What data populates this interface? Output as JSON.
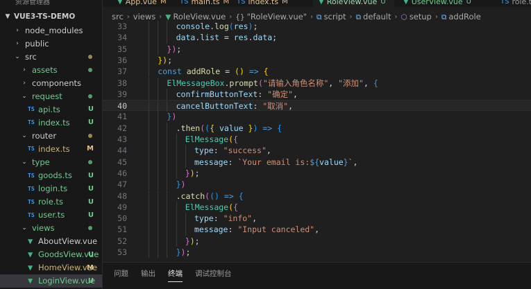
{
  "sidebar": {
    "header": "资源管理器",
    "project": "VUE3-TS-DEMO",
    "items": [
      {
        "label": "node_modules",
        "kind": "folder",
        "depth": 1,
        "open": false,
        "status": "",
        "color": "normal"
      },
      {
        "label": "public",
        "kind": "folder",
        "depth": 1,
        "open": false,
        "status": "",
        "color": "normal"
      },
      {
        "label": "src",
        "kind": "folder",
        "depth": 1,
        "open": true,
        "status": "dot",
        "color": "normal"
      },
      {
        "label": "assets",
        "kind": "folder",
        "depth": 2,
        "open": false,
        "status": "dot-green",
        "color": "folder-git"
      },
      {
        "label": "components",
        "kind": "folder",
        "depth": 2,
        "open": false,
        "status": "",
        "color": "normal"
      },
      {
        "label": "request",
        "kind": "folder",
        "depth": 2,
        "open": true,
        "status": "dot-green",
        "color": "folder-git"
      },
      {
        "label": "api.ts",
        "kind": "ts",
        "depth": 3,
        "open": false,
        "status": "U",
        "color": "untracked"
      },
      {
        "label": "index.ts",
        "kind": "ts",
        "depth": 3,
        "open": false,
        "status": "U",
        "color": "untracked"
      },
      {
        "label": "router",
        "kind": "folder",
        "depth": 2,
        "open": true,
        "status": "dot",
        "color": "normal"
      },
      {
        "label": "index.ts",
        "kind": "ts",
        "depth": 3,
        "open": false,
        "status": "M",
        "color": "modified"
      },
      {
        "label": "type",
        "kind": "folder",
        "depth": 2,
        "open": true,
        "status": "dot-green",
        "color": "folder-git"
      },
      {
        "label": "goods.ts",
        "kind": "ts",
        "depth": 3,
        "open": false,
        "status": "U",
        "color": "untracked"
      },
      {
        "label": "login.ts",
        "kind": "ts",
        "depth": 3,
        "open": false,
        "status": "U",
        "color": "untracked"
      },
      {
        "label": "role.ts",
        "kind": "ts",
        "depth": 3,
        "open": false,
        "status": "U",
        "color": "untracked"
      },
      {
        "label": "user.ts",
        "kind": "ts",
        "depth": 3,
        "open": false,
        "status": "U",
        "color": "untracked"
      },
      {
        "label": "views",
        "kind": "folder",
        "depth": 2,
        "open": true,
        "status": "dot-green",
        "color": "folder-git"
      },
      {
        "label": "AboutView.vue",
        "kind": "vue",
        "depth": 3,
        "open": false,
        "status": "",
        "color": "normal"
      },
      {
        "label": "GoodsView.vue",
        "kind": "vue",
        "depth": 3,
        "open": false,
        "status": "U",
        "color": "untracked"
      },
      {
        "label": "HomeView.vue",
        "kind": "vue",
        "depth": 3,
        "open": false,
        "status": "M",
        "color": "modified"
      },
      {
        "label": "LoginView.vue",
        "kind": "vue",
        "depth": 3,
        "open": false,
        "status": "U",
        "color": "untracked"
      }
    ]
  },
  "tabs": [
    {
      "label": "App.vue",
      "icon": "vue",
      "status": "M",
      "active": false
    },
    {
      "label": "main.ts",
      "icon": "ts",
      "status": "M",
      "active": false
    },
    {
      "label": "index.ts",
      "icon": "ts",
      "status": "M",
      "active": false
    },
    {
      "label": "RoleView.vue",
      "icon": "vue",
      "status": "U",
      "active": true
    },
    {
      "label": "UserView.vue",
      "icon": "vue",
      "status": "U",
      "active": false
    },
    {
      "label": "role.ts",
      "icon": "ts",
      "status": "",
      "active": false
    }
  ],
  "breadcrumb": [
    {
      "label": "src",
      "icon": ""
    },
    {
      "label": "views",
      "icon": ""
    },
    {
      "label": "RoleView.vue",
      "icon": "vue"
    },
    {
      "label": "\"RoleView.vue\"",
      "icon": "{}"
    },
    {
      "label": "script",
      "icon": "box"
    },
    {
      "label": "default",
      "icon": "box"
    },
    {
      "label": "setup",
      "icon": "cube"
    },
    {
      "label": "addRole",
      "icon": "box"
    }
  ],
  "editor": {
    "current_line": 40,
    "lines": [
      {
        "n": 33,
        "indent": 3,
        "tokens": [
          [
            "var",
            "console"
          ],
          [
            "txt",
            "."
          ],
          [
            "fn",
            "log"
          ],
          [
            "p3",
            "("
          ],
          [
            "var",
            "res"
          ],
          [
            "p3",
            ")"
          ],
          [
            "txt",
            ";"
          ]
        ]
      },
      {
        "n": 34,
        "indent": 3,
        "tokens": [
          [
            "var",
            "data"
          ],
          [
            "txt",
            "."
          ],
          [
            "var",
            "list"
          ],
          [
            "txt",
            " = "
          ],
          [
            "var",
            "res"
          ],
          [
            "txt",
            "."
          ],
          [
            "var",
            "data"
          ],
          [
            "txt",
            ";"
          ]
        ]
      },
      {
        "n": 35,
        "indent": 2,
        "tokens": [
          [
            "p2",
            "}"
          ],
          [
            "p2",
            ")"
          ],
          [
            "txt",
            ";"
          ]
        ]
      },
      {
        "n": 36,
        "indent": 1,
        "tokens": [
          [
            "p1",
            "}"
          ],
          [
            "p1",
            ")"
          ],
          [
            "txt",
            ";"
          ]
        ]
      },
      {
        "n": 37,
        "indent": 1,
        "tokens": [
          [
            "kw",
            "const"
          ],
          [
            "txt",
            " "
          ],
          [
            "fn",
            "addRole"
          ],
          [
            "txt",
            " = "
          ],
          [
            "p1",
            "("
          ],
          [
            "p1",
            ")"
          ],
          [
            "txt",
            " "
          ],
          [
            "kw",
            "=>"
          ],
          [
            "txt",
            " "
          ],
          [
            "p1",
            "{"
          ]
        ]
      },
      {
        "n": 38,
        "indent": 2,
        "tokens": [
          [
            "cls",
            "ElMessageBox"
          ],
          [
            "txt",
            "."
          ],
          [
            "fn",
            "prompt"
          ],
          [
            "p2",
            "("
          ],
          [
            "str",
            "\"请输入角色名称\""
          ],
          [
            "txt",
            ", "
          ],
          [
            "str",
            "\"添加\""
          ],
          [
            "txt",
            ", "
          ],
          [
            "p3",
            "{"
          ]
        ]
      },
      {
        "n": 39,
        "indent": 3,
        "tokens": [
          [
            "var",
            "confirmButtonText"
          ],
          [
            "txt",
            ": "
          ],
          [
            "str",
            "\"确定\""
          ],
          [
            "txt",
            ","
          ]
        ]
      },
      {
        "n": 40,
        "indent": 3,
        "tokens": [
          [
            "var",
            "cancelButtonText"
          ],
          [
            "txt",
            ": "
          ],
          [
            "str",
            "\"取消\""
          ],
          [
            "txt",
            ","
          ]
        ]
      },
      {
        "n": 41,
        "indent": 2,
        "tokens": [
          [
            "p3",
            "}"
          ],
          [
            "p2",
            ")"
          ]
        ]
      },
      {
        "n": 42,
        "indent": 3,
        "tokens": [
          [
            "txt",
            "."
          ],
          [
            "fn",
            "then"
          ],
          [
            "p2",
            "("
          ],
          [
            "p3",
            "("
          ],
          [
            "p1",
            "{"
          ],
          [
            "txt",
            " "
          ],
          [
            "var",
            "value"
          ],
          [
            "txt",
            " "
          ],
          [
            "p1",
            "}"
          ],
          [
            "p3",
            ")"
          ],
          [
            "txt",
            " "
          ],
          [
            "kw",
            "=>"
          ],
          [
            "txt",
            " "
          ],
          [
            "p3",
            "{"
          ]
        ]
      },
      {
        "n": 43,
        "indent": 4,
        "tokens": [
          [
            "cls",
            "ElMessage"
          ],
          [
            "p1",
            "("
          ],
          [
            "p2",
            "{"
          ]
        ]
      },
      {
        "n": 44,
        "indent": 5,
        "tokens": [
          [
            "var",
            "type"
          ],
          [
            "txt",
            ": "
          ],
          [
            "str",
            "\"success\""
          ],
          [
            "txt",
            ","
          ]
        ]
      },
      {
        "n": 45,
        "indent": 5,
        "tokens": [
          [
            "var",
            "message"
          ],
          [
            "txt",
            ": "
          ],
          [
            "str",
            "`Your email is:"
          ],
          [
            "kw",
            "${"
          ],
          [
            "var",
            "value"
          ],
          [
            "kw",
            "}"
          ],
          [
            "str",
            "`"
          ],
          [
            "txt",
            ","
          ]
        ]
      },
      {
        "n": 46,
        "indent": 4,
        "tokens": [
          [
            "p2",
            "}"
          ],
          [
            "p1",
            ")"
          ],
          [
            "txt",
            ";"
          ]
        ]
      },
      {
        "n": 47,
        "indent": 3,
        "tokens": [
          [
            "p3",
            "}"
          ],
          [
            "p2",
            ")"
          ]
        ]
      },
      {
        "n": 48,
        "indent": 3,
        "tokens": [
          [
            "txt",
            "."
          ],
          [
            "fn",
            "catch"
          ],
          [
            "p2",
            "("
          ],
          [
            "p3",
            "("
          ],
          [
            "p3",
            ")"
          ],
          [
            "txt",
            " "
          ],
          [
            "kw",
            "=>"
          ],
          [
            "txt",
            " "
          ],
          [
            "p3",
            "{"
          ]
        ]
      },
      {
        "n": 49,
        "indent": 4,
        "tokens": [
          [
            "cls",
            "ElMessage"
          ],
          [
            "p1",
            "("
          ],
          [
            "p2",
            "{"
          ]
        ]
      },
      {
        "n": 50,
        "indent": 5,
        "tokens": [
          [
            "var",
            "type"
          ],
          [
            "txt",
            ": "
          ],
          [
            "str",
            "\"info\""
          ],
          [
            "txt",
            ","
          ]
        ]
      },
      {
        "n": 51,
        "indent": 5,
        "tokens": [
          [
            "var",
            "message"
          ],
          [
            "txt",
            ": "
          ],
          [
            "str",
            "\"Input canceled\""
          ],
          [
            "txt",
            ","
          ]
        ]
      },
      {
        "n": 52,
        "indent": 4,
        "tokens": [
          [
            "p2",
            "}"
          ],
          [
            "p1",
            ")"
          ],
          [
            "txt",
            ";"
          ]
        ]
      },
      {
        "n": 53,
        "indent": 3,
        "tokens": [
          [
            "p3",
            "}"
          ],
          [
            "p2",
            ")"
          ],
          [
            "txt",
            ";"
          ]
        ]
      }
    ]
  },
  "panel": {
    "tabs": [
      {
        "label": "问题",
        "active": false
      },
      {
        "label": "输出",
        "active": false
      },
      {
        "label": "终端",
        "active": true
      },
      {
        "label": "调试控制台",
        "active": false
      }
    ]
  }
}
